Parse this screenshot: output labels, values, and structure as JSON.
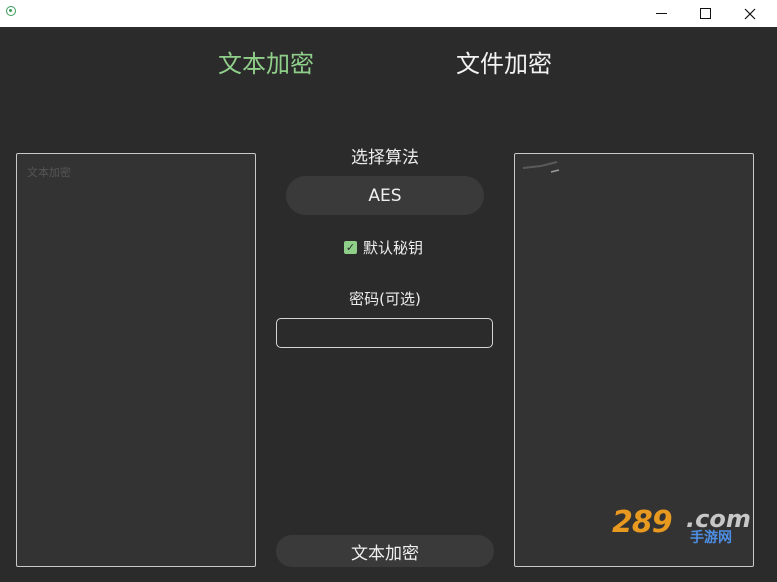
{
  "window": {
    "minimize_icon": "minimize-icon",
    "maximize_icon": "maximize-icon",
    "close_icon": "close-icon"
  },
  "tabs": {
    "text": "文本加密",
    "file": "文件加密",
    "active": "text",
    "active_color": "#8fcf8a"
  },
  "input": {
    "placeholder": "文本加密",
    "value": ""
  },
  "algorithm": {
    "label": "选择算法",
    "selected": "AES"
  },
  "default_key": {
    "label": "默认秘钥",
    "checked": true
  },
  "password": {
    "label": "密码(可选)",
    "value": ""
  },
  "action": {
    "label": "文本加密"
  },
  "output": {
    "value": ""
  },
  "watermark": {
    "number": "289",
    "domain": ".com",
    "subtitle": "手游网"
  }
}
